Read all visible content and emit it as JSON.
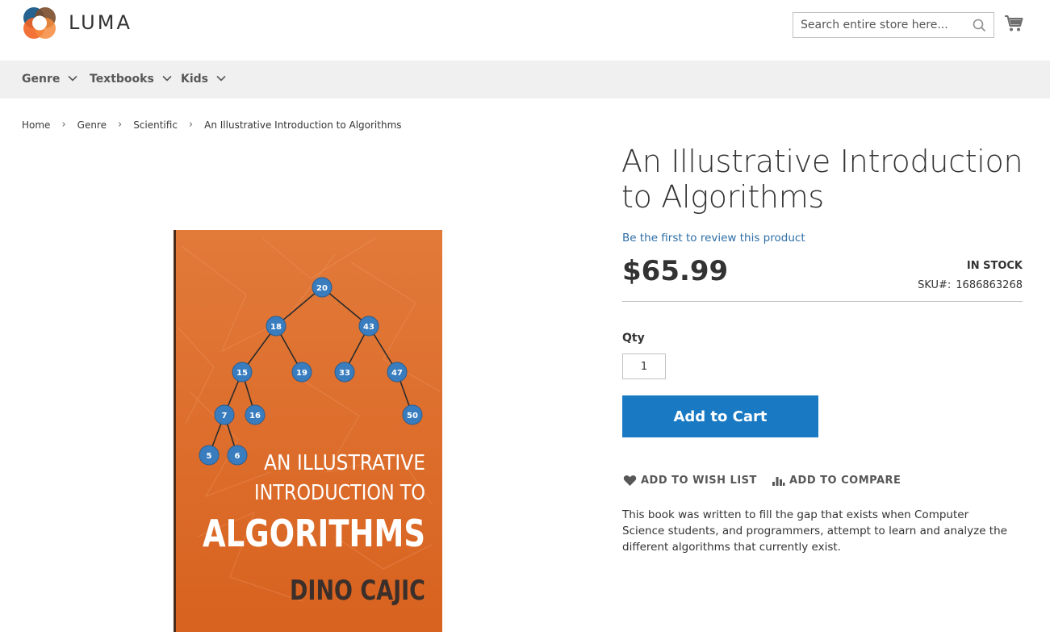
{
  "header": {
    "logo_text": "LUMA",
    "search_placeholder": "Search entire store here...",
    "search_icon": "search-icon",
    "cart_icon": "cart-icon"
  },
  "nav": {
    "items": [
      {
        "label": "Genre",
        "icon": "chevron-down-icon"
      },
      {
        "label": "Textbooks",
        "icon": "chevron-down-icon"
      },
      {
        "label": "Kids",
        "icon": "chevron-down-icon"
      }
    ]
  },
  "breadcrumb": {
    "items": [
      "Home",
      "Genre",
      "Scientific"
    ],
    "current": "An Illustrative Introduction to Algorithms",
    "separator": "›"
  },
  "product": {
    "title": "An Illustrative Introduction to Algorithms",
    "review_link": "Be the first to review this product",
    "price": "$65.99",
    "stock": "IN STOCK",
    "sku_label": "SKU#:",
    "sku_value": "1686863268",
    "qty_label": "Qty",
    "qty_value": "1",
    "add_to_cart": "Add to Cart",
    "wishlist": "ADD TO WISH LIST",
    "compare": "ADD TO COMPARE",
    "description": "This book was written to fill the gap that exists when Computer Science students, and programmers, attempt to learn and analyze the different algorithms that currently exist.",
    "cover": {
      "title_line1": "AN ILLUSTRATIVE",
      "title_line2": "INTRODUCTION TO",
      "title_line3": "ALGORITHMS",
      "author": "DINO CAJIC",
      "tree_nodes": [
        "20",
        "18",
        "43",
        "15",
        "19",
        "33",
        "47",
        "7",
        "16",
        "50",
        "5",
        "6"
      ]
    }
  },
  "colors": {
    "accent": "#1979c3",
    "nav_bg": "#f0f0f0",
    "cover_orange": "#e0672a",
    "node_blue": "#3a7dbf"
  }
}
